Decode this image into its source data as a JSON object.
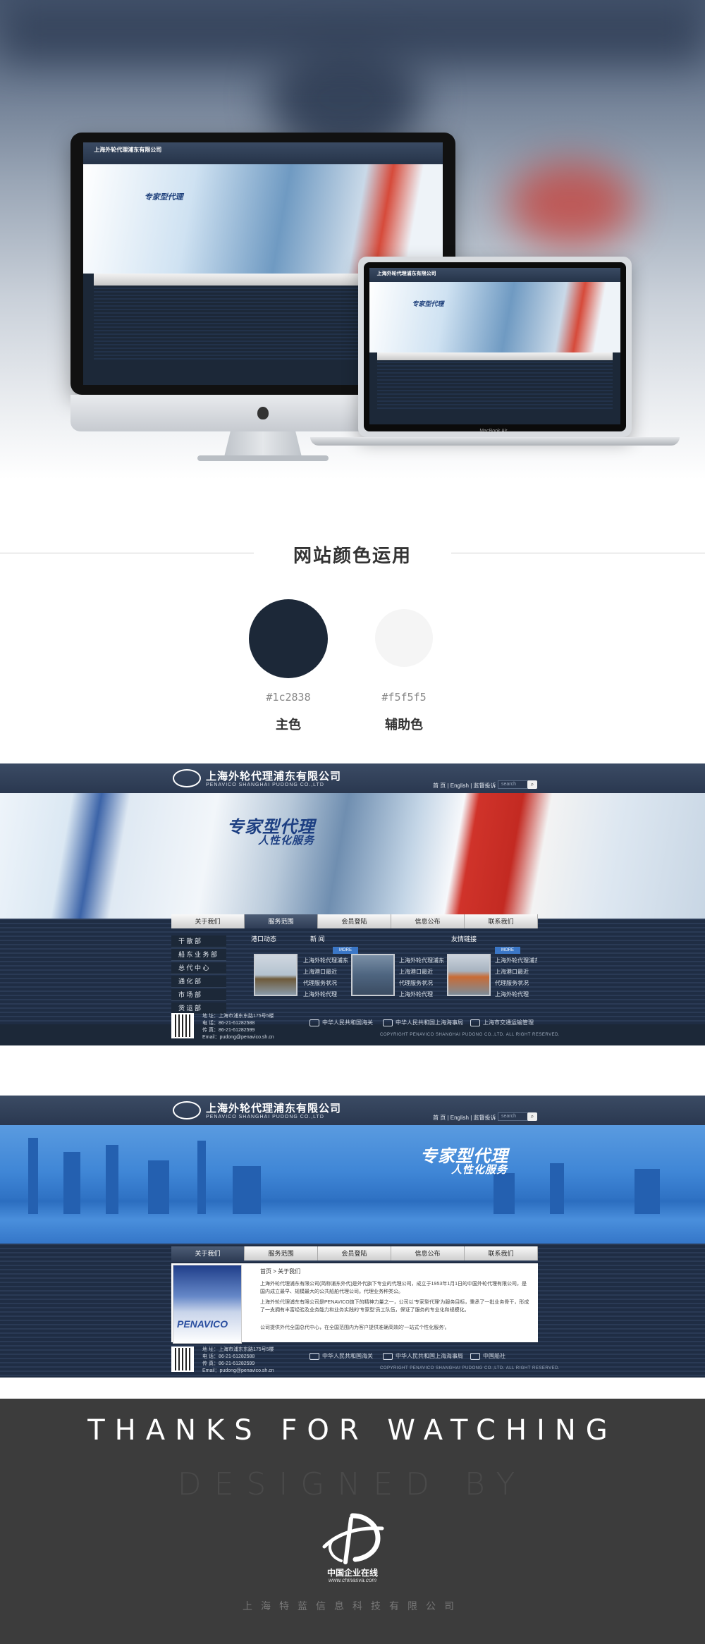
{
  "site": {
    "logo_cn": "上海外轮代理浦东有限公司",
    "logo_en": "PENAVICO SHANGHAI PUDONG CO.,LTD",
    "top_links": "首 页 | English | 监督投诉",
    "search_placeholder": "search",
    "slogan_main": "专家型代理",
    "slogan_sub": "人性化服务",
    "nav": [
      "关于我们",
      "服务范围",
      "会员登陆",
      "信息公布",
      "联系我们"
    ],
    "side_menu": [
      "干 散 部",
      "船 东 业 务 部",
      "总 代 中 心",
      "通 化 部",
      "市 场 部",
      "货 运 部"
    ],
    "port_news_title": "港口动态",
    "news_title": "新  闻",
    "links_title": "友情链接",
    "more_label": "MORE",
    "news_items_1": [
      "上海外轮代理浦东",
      "上海港口最近",
      "代理服务状况",
      "上海外轮代理"
    ],
    "news_items_2": [
      "上海外轮代理浦东",
      "上海港口最近",
      "代理服务状况",
      "上海外轮代理"
    ],
    "news_items_3": [
      "上海外轮代理浦东",
      "上海港口最近",
      "代理服务状况",
      "上海外轮代理"
    ],
    "footer": {
      "address": "地  址：上海市浦东东路175号5楼",
      "phone": "电  话：86-21-61282588",
      "fax": "传  真：86-21-61282599",
      "email": "Email：pudong@penavico.sh.cn",
      "badge1": "中华人民共和国海关",
      "badge2": "中华人民共和国上海海事局",
      "badge3": "上海市交通运输管理",
      "copyright": "COPYRIGHT PENAVICO SHANGHAI PUDONG CO.,LTD. ALL RIGHT RESERVED."
    }
  },
  "colors": {
    "section_title": "网站颜色运用",
    "primary_hex": "#1c2838",
    "primary_name": "主色",
    "secondary_hex": "#f5f5f5",
    "secondary_name": "辅助色"
  },
  "about": {
    "breadcrumb": "首页 > 关于我们",
    "para1": "上海外轮代理浦东有限公司(简称浦东外代)是外代旗下专业的代理公司，成立于1953年1月1日的中国外轮代理有限公司，是国内成立最早、规模最大的公共船舶代理公司。代理业务种类公。",
    "para2": "上海外轮代理浦东有限公司是PENAVICO旗下的精神力量之一，公司以'专家型代理'为服务目标，秉承了一批业务骨干，形成了一支拥有丰富经验及业务能力和业务实践的'专家型'员工队伍，保证了服务的专业化和规模化。",
    "para3": "公司提供外代全国总代中心，在全国范围内为客户提供准确高效的'一站式个性化服务'。",
    "image_text": "PENAVICO",
    "badge3": "中国船社"
  },
  "thanks": {
    "title": "THANKS FOR WATCHING",
    "designed_by": "DESIGNED BY",
    "brand_cn": "中国企业在线",
    "brand_url": "www.chinasva.com",
    "company": "上海特蓝信息科技有限公司"
  },
  "mockup": {
    "laptop_label": "MacBook Air"
  }
}
